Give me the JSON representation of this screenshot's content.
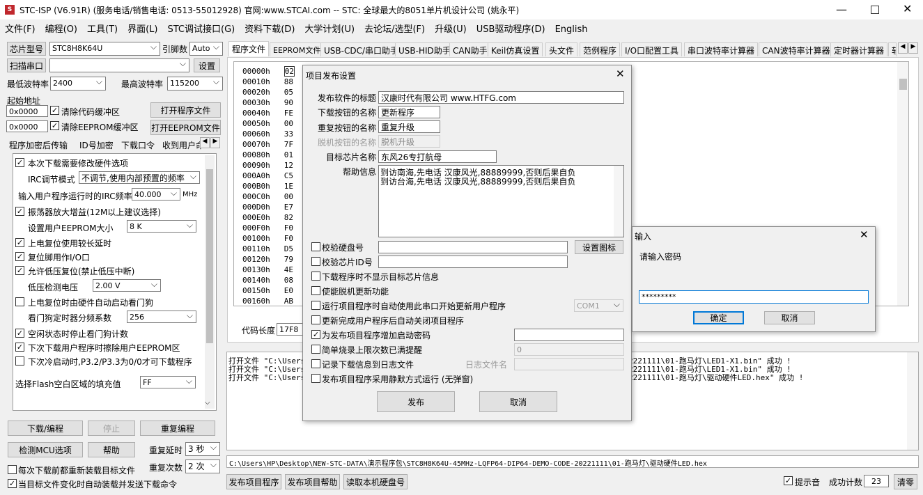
{
  "window": {
    "title": "STC-ISP (V6.91R) (服务电话/销售电话: 0513-55012928) 官网:www.STCAI.com  -- STC: 全球最大的8051单片机设计公司 (姚永平)"
  },
  "menu": [
    "文件(F)",
    "编程(O)",
    "工具(T)",
    "界面(L)",
    "STC调试接口(G)",
    "资料下载(D)",
    "大学计划(U)",
    "去论坛/选型(F)",
    "升级(U)",
    "USB驱动程序(D)",
    "English"
  ],
  "left": {
    "chip_label": "芯片型号",
    "chip_value": "STC8H8K64U",
    "pin_label": "引脚数",
    "pin_value": "Auto",
    "scan_label": "扫描串口",
    "port_value": "",
    "settings_label": "设置",
    "min_baud_label": "最低波特率",
    "min_baud": "2400",
    "max_baud_label": "最高波特率",
    "max_baud": "115200",
    "start_addr_label": "起始地址",
    "addr1": "0x0000",
    "clear_code": "清除代码缓冲区",
    "open_prog": "打开程序文件",
    "addr2": "0x0000",
    "clear_eeprom": "清除EEPROM缓冲区",
    "open_eeprom": "打开EEPROM文件",
    "tabs": [
      "程序加密后传输",
      "ID号加密",
      "下载口令",
      "收到用户命"
    ],
    "options": {
      "hw_opt": "本次下载需要修改硬件选项",
      "irc_mode_label": "IRC调节模式",
      "irc_mode": "不调节,使用内部预置的频率",
      "irc_freq_label": "输入用户程序运行时的IRC频率",
      "irc_freq": "40.000",
      "mhz": "MHz",
      "osc_gain": "振荡器放大增益(12M以上建议选择)",
      "eeprom_size_label": "设置用户EEPROM大小",
      "eeprom_size": "8    K",
      "por_delay": "上电复位使用较长延时",
      "reset_io": "复位脚用作I/O口",
      "lvr": "允许低压复位(禁止低压中断)",
      "lvd_label": "低压检测电压",
      "lvd": "2.00 V",
      "wdt_hw": "上电复位时由硬件自动启动看门狗",
      "wdt_div_label": "看门狗定时器分频系数",
      "wdt_div": "256",
      "idle_wdt": "空闲状态时停止看门狗计数",
      "erase_eeprom": "下次下载用户程序时擦除用户EEPROM区",
      "p32": "下次冷启动时,P3.2/P3.3为0/0才可下载程序",
      "fill_label": "选择Flash空白区域的填充值",
      "fill": "FF"
    },
    "download": "下载/编程",
    "stop": "停止",
    "reprogram": "重复编程",
    "check_mcu": "检测MCU选项",
    "help": "帮助",
    "repeat_delay_label": "重复延时",
    "repeat_delay": "3 秒",
    "repeat_count_label": "重复次数",
    "repeat_count": "2 次",
    "reload": "每次下载前都重新装载目标文件",
    "auto_load": "当目标文件变化时自动装载并发送下载命令"
  },
  "right_tabs": [
    "程序文件",
    "EEPROM文件",
    "USB-CDC/串口助手",
    "USB-HID助手",
    "CAN助手",
    "Keil仿真设置",
    "头文件",
    "范例程序",
    "I/O口配置工具",
    "串口波特率计算器",
    "CAN波特率计算器",
    "定时器计算器",
    "软"
  ],
  "hex": {
    "addresses": [
      "00000h",
      "00010h",
      "00020h",
      "00030h",
      "00040h",
      "00050h",
      "00060h",
      "00070h",
      "00080h",
      "00090h",
      "000A0h",
      "000B0h",
      "000C0h",
      "000D0h",
      "000E0h",
      "000F0h",
      "00100h",
      "00110h",
      "00120h",
      "00130h",
      "00140h",
      "00150h",
      "00160h"
    ],
    "bytes": [
      "02",
      "88",
      "05",
      "90",
      "FE",
      "00",
      "33",
      "7F",
      "01",
      "12",
      "C5",
      "1E",
      "00",
      "E7",
      "82",
      "F0",
      "F0",
      "D5",
      "79",
      "4E",
      "08",
      "E0",
      "AB"
    ],
    "code_len_label": "代码长度",
    "code_len": "17F8"
  },
  "log": [
    "打开文件 \"C:\\Users",
    "打开文件 \"C:\\Users",
    "打开文件 \"C:\\Users"
  ],
  "log_right": [
    "2221111\\01-跑马灯\\LED1-X1.bin\" 成功 !",
    "2221111\\01-跑马灯\\LED1-X1.bin\" 成功 !",
    "2221111\\01-跑马灯\\驱动硬件LED.hex\" 成功 !"
  ],
  "path": "C:\\Users\\HP\\Desktop\\NEW-STC-DATA\\演示程序包\\STC8H8K64U-45MHz-LQFP64-DIP64-DEMO-CODE-20221111\\01-跑马灯\\驱动硬件LED.hex",
  "bottom": {
    "publish": "发布项目程序",
    "publish_help": "发布项目帮助",
    "read_disk": "读取本机硬盘号",
    "sound": "提示音",
    "success_label": "成功计数",
    "success": "23",
    "clear": "清零"
  },
  "dialog": {
    "title": "项目发布设置",
    "pub_title_label": "发布软件的标题",
    "pub_title": "汉康时代有限公司 www.HTFG.com",
    "dl_btn_label": "下载按钮的名称",
    "dl_btn": "更新程序",
    "repeat_btn_label": "重复按钮的名称",
    "repeat_btn": "重复升级",
    "offline_btn_label": "脱机按钮的名称",
    "offline_btn": "脱机升级",
    "target_label": "目标芯片名称",
    "target": "东风26专打航母",
    "help_label": "帮助信息",
    "help_line1": "到访南海,先电话 汉康风光,88889999,否则后果自负",
    "help_line2": "到访台海,先电话 汉康风光,88889999,否则后果自负",
    "check_disk": "校验硬盘号",
    "set_icon": "设置图标",
    "check_chip": "校验芯片ID号",
    "no_target_info": "下载程序时不显示目标芯片信息",
    "offline_update": "使能脱机更新功能",
    "auto_update": "运行项目程序时自动使用此串口开始更新用户程序",
    "com": "COM1",
    "auto_close": "更新完成用户程序后自动关闭项目程序",
    "add_pwd": "为发布项目程序增加启动密码",
    "limit": "简单烧录上限次数已满提醒",
    "limit_val": "0",
    "log_info": "记录下载信息到日志文件",
    "log_name_label": "日志文件名",
    "silent": "发布项目程序采用静默方式运行 (无弹窗)",
    "publish": "发布",
    "cancel": "取消"
  },
  "pwd": {
    "title": "输入",
    "prompt": "请输入密码",
    "value": "*********",
    "ok": "确定",
    "cancel": "取消"
  }
}
